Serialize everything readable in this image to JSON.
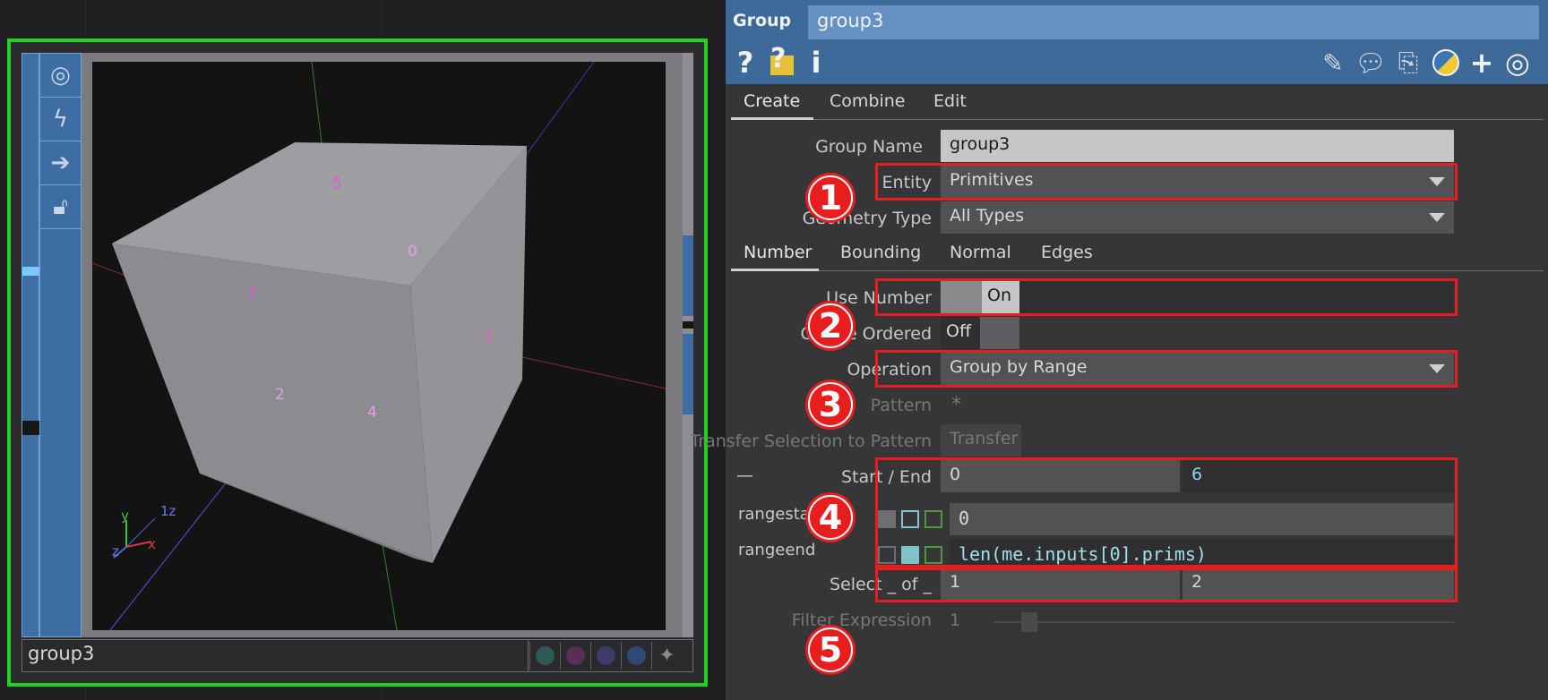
{
  "viewer": {
    "node_name": "group3",
    "viewport_labels": [
      "5",
      "0",
      "3",
      "1",
      "2",
      "4"
    ],
    "axis_labels": {
      "y": "y",
      "z": "z",
      "x": "x",
      "z2": "1z"
    }
  },
  "panel": {
    "op_type": "Group",
    "op_name": "group3",
    "toolbar_icons": [
      "help-icon",
      "help-python-icon",
      "info-icon",
      "edit-icon",
      "comment-icon",
      "compare-icon",
      "python-icon",
      "add-icon",
      "target-icon"
    ],
    "toolbar_glyphs": {
      "help": "?",
      "info": "i"
    },
    "page_tabs": [
      "Create",
      "Combine",
      "Edit"
    ],
    "sub_tabs": [
      "Number",
      "Bounding",
      "Normal",
      "Edges"
    ],
    "params": {
      "group_name": {
        "label": "Group Name",
        "value": "group3"
      },
      "entity": {
        "label": "Entity",
        "value": "Primitives"
      },
      "geometry_type": {
        "label": "Geometry Type",
        "value": "All Types"
      },
      "use_number": {
        "label": "Use Number",
        "value": "On"
      },
      "create_ordered": {
        "label": "Create Ordered",
        "value": "Off"
      },
      "operation": {
        "label": "Operation",
        "value": "Group by Range"
      },
      "pattern": {
        "label": "Pattern",
        "value": "*"
      },
      "transfer": {
        "label": "Transfer Selection to Pattern",
        "button": "Transfer"
      },
      "start_end": {
        "label": "Start / End",
        "start": "0",
        "end": "6",
        "collapse": "—"
      },
      "rangestart": {
        "label": "rangestart",
        "value": "0"
      },
      "rangeend": {
        "label": "rangeend",
        "value": "len(me.inputs[0].prims)"
      },
      "select_of": {
        "label": "Select _ of _",
        "a": "1",
        "b": "2"
      },
      "filter_expression": {
        "label": "Filter Expression",
        "value": "1"
      }
    },
    "annotations": [
      "1",
      "2",
      "3",
      "4",
      "5"
    ],
    "colors": {
      "highlight_red": "#e81d1d",
      "node_selected_green": "#1ed51e",
      "title_blue": "#3d6a98"
    }
  }
}
